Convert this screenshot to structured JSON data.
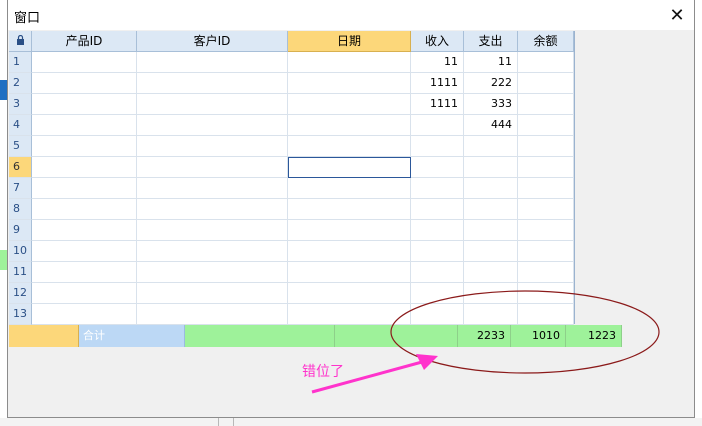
{
  "window": {
    "title": "窗口",
    "close_glyph": "✕"
  },
  "grid": {
    "corner_icon": "lock-icon",
    "columns": [
      "产品ID",
      "客户ID",
      "日期",
      "收入",
      "支出",
      "余额"
    ],
    "selected_column": "日期",
    "selected_row": "6",
    "rows": [
      {
        "n": "1",
        "income": "11",
        "expense": "11"
      },
      {
        "n": "2",
        "income": "1111",
        "expense": "222"
      },
      {
        "n": "3",
        "income": "1111",
        "expense": "333"
      },
      {
        "n": "4",
        "income": "",
        "expense": "444"
      },
      {
        "n": "5",
        "income": "",
        "expense": ""
      },
      {
        "n": "6",
        "income": "",
        "expense": ""
      },
      {
        "n": "7",
        "income": "",
        "expense": ""
      },
      {
        "n": "8",
        "income": "",
        "expense": ""
      },
      {
        "n": "9",
        "income": "",
        "expense": ""
      },
      {
        "n": "10",
        "income": "",
        "expense": ""
      },
      {
        "n": "11",
        "income": "",
        "expense": ""
      },
      {
        "n": "12",
        "income": "",
        "expense": ""
      },
      {
        "n": "13",
        "income": "",
        "expense": ""
      }
    ]
  },
  "footer": {
    "label": "合计",
    "income_total": "2233",
    "expense_total": "1010",
    "balance_total": "1223"
  },
  "annotation": {
    "text": "错位了",
    "color": "#ff33cc",
    "ellipse_color": "#8b1a1a"
  },
  "colors": {
    "header_bg": "#dce8f5",
    "selected_header": "#fcd77a",
    "footer_green": "#9ef29a",
    "footer_blue": "#bcd8f5"
  }
}
